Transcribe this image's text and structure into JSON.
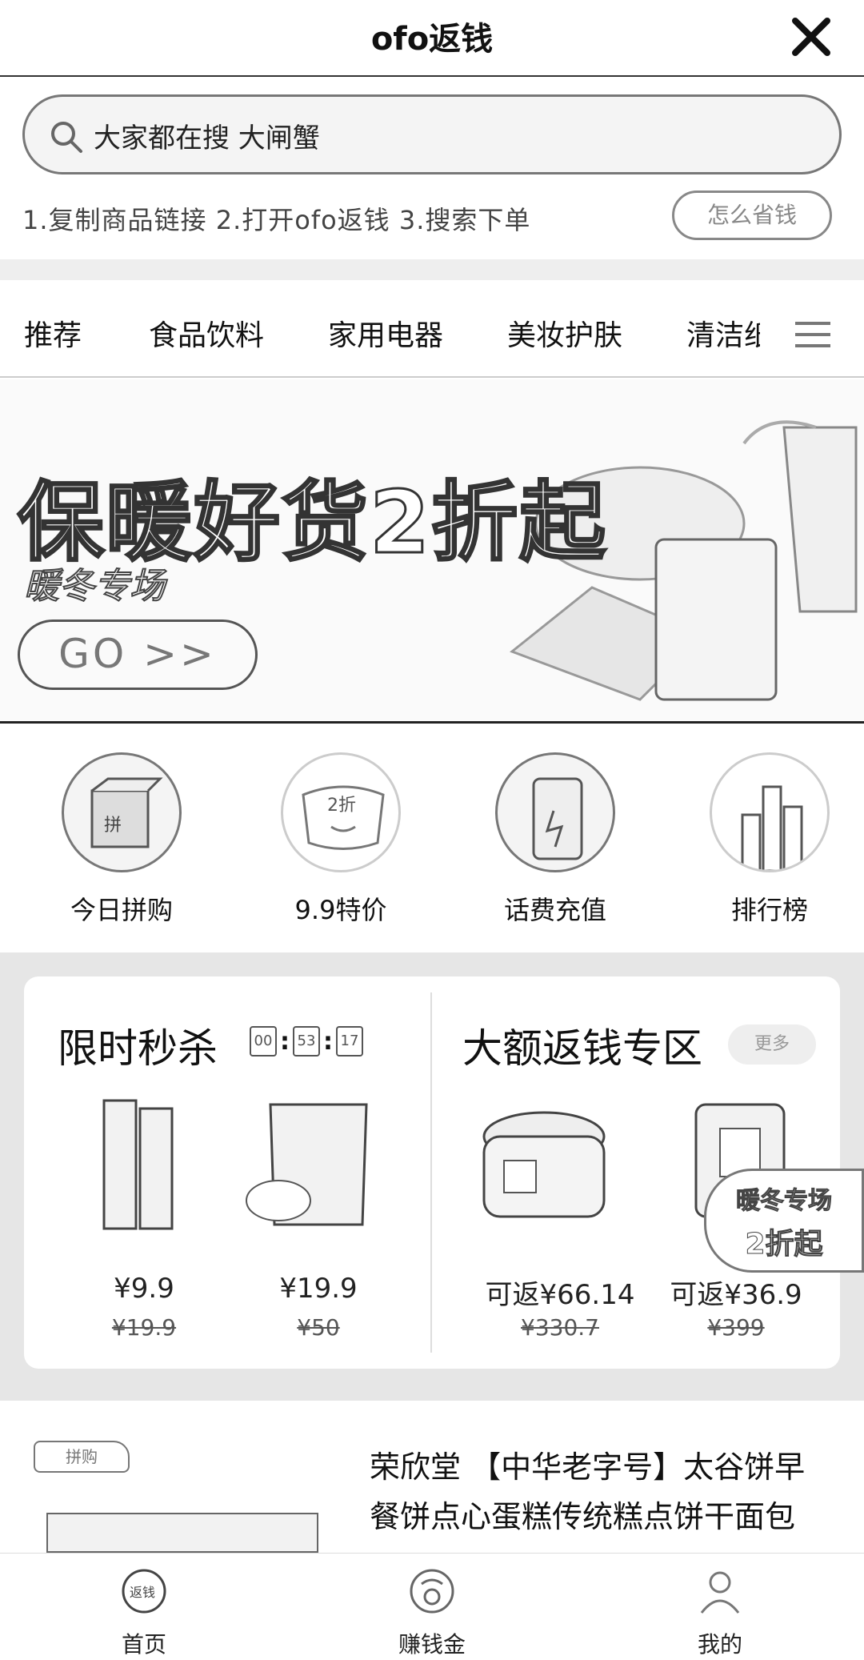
{
  "header": {
    "title": "ofo返钱"
  },
  "search": {
    "placeholder": "大家都在搜 大闸蟹"
  },
  "steps": {
    "text": "1.复制商品链接 2.打开ofo返钱 3.搜索下单",
    "button": "怎么省钱"
  },
  "tabs": [
    "推荐",
    "食品饮料",
    "家用电器",
    "美妆护肤",
    "清洁纸"
  ],
  "banner": {
    "headline": "保暖好货2折起",
    "subtitle": "暖冬专场",
    "button": "GO >>"
  },
  "quick_links": [
    {
      "label": "今日拼购",
      "icon": "group-buy-icon"
    },
    {
      "label": "9.9特价",
      "icon": "discount-icon"
    },
    {
      "label": "话费充值",
      "icon": "phone-recharge-icon"
    },
    {
      "label": "排行榜",
      "icon": "ranking-icon"
    }
  ],
  "flash_sale": {
    "title": "限时秒杀",
    "timer": [
      "00",
      "53",
      "17"
    ],
    "items": [
      {
        "price": "¥9.9",
        "original": "¥19.9"
      },
      {
        "price": "¥19.9",
        "original": "¥50"
      }
    ]
  },
  "big_cashback": {
    "title": "大额返钱专区",
    "pill": "更多",
    "items": [
      {
        "price": "可返¥66.14",
        "original": "¥330.7"
      },
      {
        "price": "可返¥36.9",
        "original": "¥399"
      }
    ]
  },
  "float_badge": {
    "line1": "暖冬专场",
    "line2": "2折起"
  },
  "product_card": {
    "tag": "拼购",
    "name": "荣欣堂 【中华老字号】太谷饼早餐饼点心蛋糕传统糕点饼干面包"
  },
  "bottom_nav": [
    {
      "label": "首页",
      "icon": "cashback-home-icon"
    },
    {
      "label": "赚钱金",
      "icon": "coin-icon"
    },
    {
      "label": "我的",
      "icon": "profile-icon"
    }
  ]
}
